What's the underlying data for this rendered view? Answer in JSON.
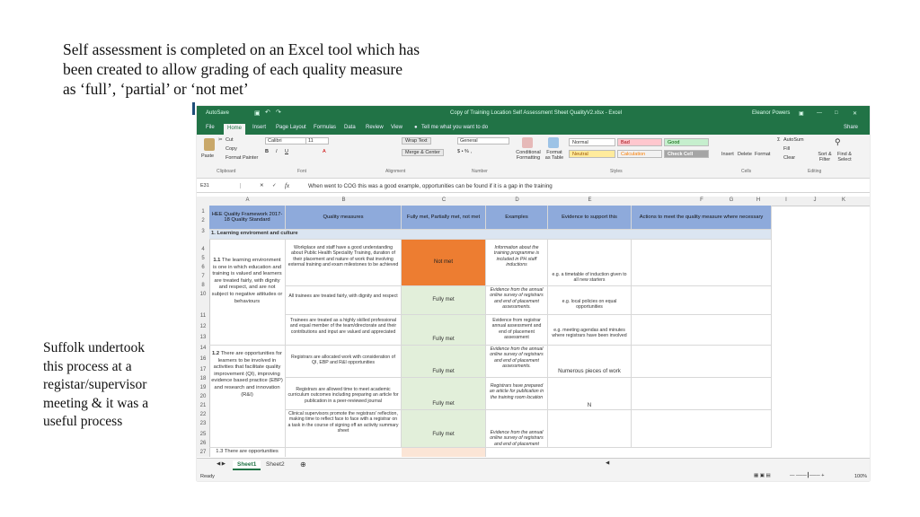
{
  "slide": {
    "heading_lines": [
      "Self assessment is completed on an Excel tool which has",
      "been created to allow grading of each quality measure",
      "as ‘full’, ‘partial’ or ‘not met’"
    ],
    "side_lines": [
      "Suffolk undertook",
      "this process at a",
      "registar/supervisor",
      "meeting & it was a",
      "useful process"
    ]
  },
  "excel": {
    "autosave": "AutoSave",
    "doc_title": "Copy of Training Location Self Assessment Sheet QualityV2.xlsx  -  Excel",
    "user": "Eleanor Powers",
    "tabs": [
      "File",
      "Home",
      "Insert",
      "Page Layout",
      "Formulas",
      "Data",
      "Review",
      "View"
    ],
    "tell_me": "Tell me what you want to do",
    "share": "Share",
    "ribbon": {
      "paste": "Paste",
      "cut": "Cut",
      "copy": "Copy",
      "format_painter": "Format Painter",
      "font_name": "Calibri",
      "font_size": "11",
      "wrap_text": "Wrap Text",
      "merge_center": "Merge & Center",
      "number_format": "General",
      "conditional": "Conditional Formatting",
      "format_as_table": "Format as Table",
      "styles": [
        "Normal",
        "Bad",
        "Good",
        "Neutral",
        "Calculation",
        "Check Cell"
      ],
      "insert": "Insert",
      "delete": "Delete",
      "format": "Format",
      "autosum": "AutoSum",
      "fill": "Fill",
      "clear": "Clear",
      "sort_filter": "Sort & Filter",
      "find_select": "Find & Select",
      "groups": [
        "Clipboard",
        "Font",
        "Alignment",
        "Number",
        "Styles",
        "Cells",
        "Editing"
      ]
    },
    "name_box": "E31",
    "fx": "fx",
    "formula": "When went to COG this was a good example, opportunities can be found if it is a gap in the training",
    "columns": [
      "A",
      "B",
      "C",
      "D",
      "E",
      "F",
      "G",
      "H",
      "I",
      "J",
      "K"
    ],
    "row_numbers": [
      "1",
      "2",
      "3",
      "4",
      "5",
      "6",
      "7",
      "8",
      "10",
      "11",
      "12",
      "13",
      "14",
      "16",
      "17",
      "18",
      "19",
      "20",
      "21",
      "22",
      "23",
      "25",
      "26",
      "27",
      "28"
    ],
    "header_row": {
      "a": "HEE Quality Framework 2017-18 Quality Standard",
      "b": "Quality measures",
      "c": "Fully met, Partially met, not met",
      "d": "Examples",
      "e": "Evidence to support this",
      "f": "Actions to meet the quality measure where necessary"
    },
    "section_title": "1. Learning enviroment and culture",
    "a_texts": {
      "s11_num": "1.1",
      "s11_text": "The learning environment is one in which education and training is valued and learners are treated fairly, with dignity and respect, and are not subject to negative attitudes or behaviours",
      "s12_num": "1.2",
      "s12_text": "There are opportunities for learners to be involved in activities that facilitate quality improvement (QI), improving evidence based practice (EBP) and research and innovation (R&I)",
      "s13": "1.3 There are opportunities"
    },
    "rows": [
      {
        "b": "Workplace and staff have a good understanding about Public Health Speciality Training, duration of their placement and nature of work that involving external training and exam milestones to be achieved",
        "c": "Not met",
        "d": "Information about the training programme is included in PH staff inductions",
        "e": "e.g. a timetable of induction given to all new starters"
      },
      {
        "b": "All trainees are treated fairly, with dignity and respect",
        "c": "Fully met",
        "d": "Evidence from the annual online survey of registrars and end of placement assessments.",
        "e": "e.g. local policies on equal opportunities"
      },
      {
        "b": "Trainees are treated as a highly skilled professional and equal member of the team/directorate and their contributions and input are valued and appreciated",
        "c": "Fully met",
        "d": "Evidence from registrar annual assessment and end of placement assessment",
        "e": "e.g. meeting agendas and minutes where registrars have been involved"
      },
      {
        "b": "Registrars are allocated work with consideration of QI, EBP and R&I opportunities",
        "c": "Fully met",
        "d": "Evidence from the annual online survey of registrars and end of placement assessments.",
        "e": "Numerous pieces of work"
      },
      {
        "b": "Registrars are allowed time to meet academic curriculum outcomes including preparing an article for publication in a peer-reviewed journal",
        "c": "Fully met",
        "d": "Registrars have prepared an article for publication in the training room location",
        "e": "N"
      },
      {
        "b": "Clinical supervisors promote the registrars' reflection, making time to reflect face to face with a registrar on a task in the course of signing off an activity summary sheet",
        "c": "Fully met",
        "d": "Evidence from the annual online survey of registrars and end of placement",
        "e": ""
      }
    ],
    "sheets": [
      "Sheet1",
      "Sheet2"
    ],
    "status_ready": "Ready",
    "zoom": "100%",
    "colors": {
      "excel_green": "#217346",
      "header_blue": "#8eaadb",
      "not_met": "#ed7d31",
      "fully_met": "#e2efda"
    }
  }
}
